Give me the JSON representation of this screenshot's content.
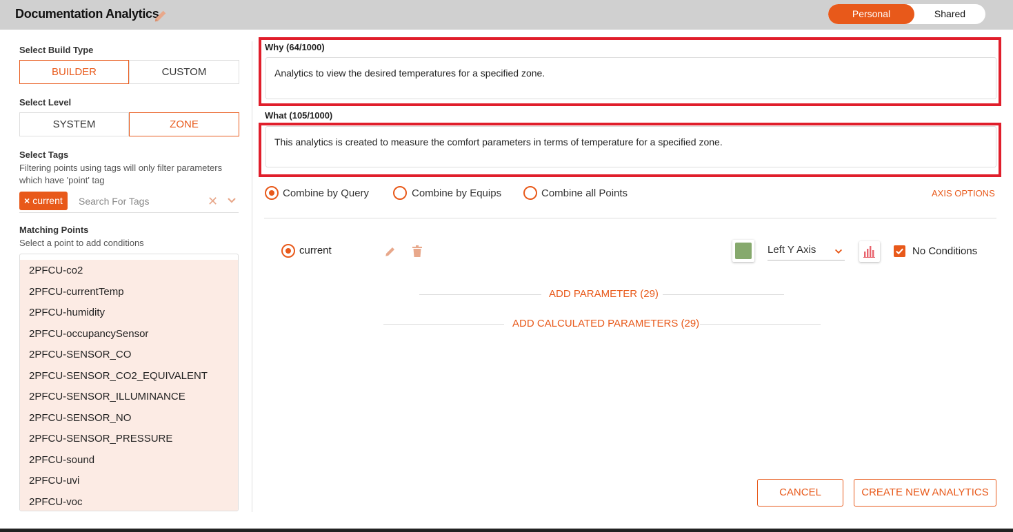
{
  "header": {
    "title": "Documentation Analytics",
    "toggle": {
      "personal": "Personal",
      "shared": "Shared",
      "selected": "Personal"
    }
  },
  "sidebar": {
    "build_type": {
      "label": "Select Build Type",
      "options": [
        "BUILDER",
        "CUSTOM"
      ],
      "selected": "BUILDER"
    },
    "level": {
      "label": "Select Level",
      "options": [
        "SYSTEM",
        "ZONE"
      ],
      "selected": "ZONE"
    },
    "tags": {
      "label": "Select Tags",
      "help": "Filtering points using tags will only filter parameters which have 'point' tag",
      "chip": "current",
      "chip_remove": "×",
      "search_placeholder": "Search For Tags",
      "clear": "✕"
    },
    "matching_points": {
      "label": "Matching Points",
      "help": "Select a point to add conditions",
      "items": [
        "2PFCU-co2",
        "2PFCU-currentTemp",
        "2PFCU-humidity",
        "2PFCU-occupancySensor",
        "2PFCU-SENSOR_CO",
        "2PFCU-SENSOR_CO2_EQUIVALENT",
        "2PFCU-SENSOR_ILLUMINANCE",
        "2PFCU-SENSOR_NO",
        "2PFCU-SENSOR_PRESSURE",
        "2PFCU-sound",
        "2PFCU-uvi",
        "2PFCU-voc"
      ]
    }
  },
  "main": {
    "why": {
      "label": "Why (64/1000)",
      "value": "Analytics to view the desired temperatures for a specified zone."
    },
    "what": {
      "label": "What (105/1000)",
      "value": "This analytics is created to measure the comfort parameters in terms of temperature for a specified zone."
    },
    "combine": {
      "options": [
        "Combine by Query",
        "Combine by Equips",
        "Combine all Points"
      ],
      "selected": "Combine by Query"
    },
    "axis_options": "AXIS OPTIONS",
    "parameter": {
      "name": "current",
      "color": "#86a96d",
      "axis": "Left Y Axis",
      "no_conditions": "No Conditions",
      "no_conditions_checked": true
    },
    "add_parameter": "ADD PARAMETER (29)",
    "add_calculated": "ADD CALCULATED PARAMETERS (29)",
    "buttons": {
      "cancel": "CANCEL",
      "create": "CREATE NEW ANALYTICS"
    }
  },
  "colors": {
    "accent": "#e8591a",
    "highlight": "#e01e2b",
    "list_bg": "#fcebe4"
  }
}
